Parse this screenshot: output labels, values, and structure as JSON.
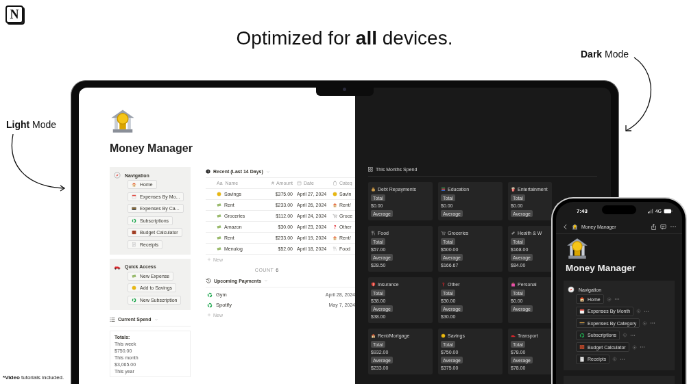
{
  "logo": {
    "text": "N"
  },
  "headline": "Optimized for **all** devices.",
  "annotations": [
    {
      "kind": "light",
      "text": "**Light** Mode"
    },
    {
      "kind": "dark",
      "text": "**Dark** Mode"
    }
  ],
  "footnote": {
    "mark": "*",
    "text": "**Video** tutorials included."
  },
  "laptop": {
    "light": {
      "page_title": "Money Manager",
      "navigation": {
        "title": "Navigation",
        "items": [
          "Home",
          "Expenses By Mo...",
          "Expenses By Ca...",
          "Subscriptions",
          "Budget Calculator",
          "Receipts"
        ]
      },
      "quick_access": {
        "title": "Quick Access",
        "items": [
          "New Expense",
          "Add to Savings",
          "New Subscription"
        ]
      },
      "current_spend": {
        "title": "Current Spend",
        "totals_title": "Totals:",
        "lines": [
          "This week",
          "$750.00",
          "This month",
          "$3,065.00",
          "This year"
        ]
      },
      "recent": {
        "title": "Recent (Last 14 Days)",
        "columns": [
          {
            "icon_text": "Aa",
            "label": "Name"
          },
          {
            "icon_text": "#",
            "label": "Amount"
          },
          {
            "label": "Date"
          },
          {
            "label": "Categ"
          }
        ],
        "rows": [
          {
            "name": "Savings",
            "amount": "$375.00",
            "date": "April 27, 2024",
            "category": "Savin"
          },
          {
            "name": "Rent",
            "amount": "$233.00",
            "date": "April 26, 2024",
            "category": "Rent/"
          },
          {
            "name": "Groceries",
            "amount": "$112.00",
            "date": "April 24, 2024",
            "category": "Groce"
          },
          {
            "name": "Amazon",
            "amount": "$30.00",
            "date": "April 23, 2024",
            "category": "Other"
          },
          {
            "name": "Rent",
            "amount": "$233.00",
            "date": "April 19, 2024",
            "category": "Rent/"
          },
          {
            "name": "Menulog",
            "amount": "$52.00",
            "date": "April 18, 2024",
            "category": "Food"
          }
        ],
        "new_label": "New",
        "count_label": "COUNT",
        "count": "6"
      },
      "upcoming": {
        "title": "Upcoming Payments",
        "rows": [
          {
            "name": "Gym",
            "date": "April 28, 2024"
          },
          {
            "name": "Spotify",
            "date": "May 7, 2024"
          }
        ],
        "new_label": "New"
      }
    },
    "dark": {
      "title": "This Months Spend",
      "cards": [
        {
          "name": "Debt Repayments",
          "total_label": "Total",
          "total": "$0.00",
          "average_label": "Average"
        },
        {
          "name": "Education",
          "total_label": "Total",
          "total": "$0.00",
          "average_label": "Average"
        },
        {
          "name": "Entertainment",
          "total_label": "Total",
          "total": "$0.00",
          "average_label": "Average"
        },
        {
          "name": "Food",
          "total_label": "Total",
          "total": "$57.00",
          "average_label": "Average",
          "average": "$28.50"
        },
        {
          "name": "Groceries",
          "total_label": "Total",
          "total": "$500.00",
          "average_label": "Average",
          "average": "$166.67"
        },
        {
          "name": "Health & W",
          "total_label": "Total",
          "total": "$168.00",
          "average_label": "Average",
          "average": "$84.00"
        },
        {
          "name": "Insurance",
          "total_label": "Total",
          "total": "$38.00",
          "average_label": "Average",
          "average": "$38.00"
        },
        {
          "name": "Other",
          "total_label": "Total",
          "total": "$30.00",
          "average_label": "Average",
          "average": "$30.00"
        },
        {
          "name": "Personal",
          "total_label": "Total",
          "total": "$0.00",
          "average_label": "Average"
        },
        {
          "name": "Rent/Mortgage",
          "total_label": "Total",
          "total": "$932.00",
          "average_label": "Average",
          "average": "$233.00"
        },
        {
          "name": "Savings",
          "total_label": "Total",
          "total": "$750.00",
          "average_label": "Average",
          "average": "$375.00"
        },
        {
          "name": "Transport",
          "total_label": "Total",
          "total": "$78.00",
          "average_label": "Average",
          "average": "$78.00"
        }
      ]
    }
  },
  "phone": {
    "time": "7:43",
    "network": "4G",
    "header_title": "Money Manager",
    "page_title": "Money Manager",
    "navigation": {
      "title": "Navigation",
      "items": [
        "Home",
        "Expenses By Month",
        "Expenses By Category",
        "Subscriptions",
        "Budget Calculator",
        "Receipts"
      ]
    }
  }
}
